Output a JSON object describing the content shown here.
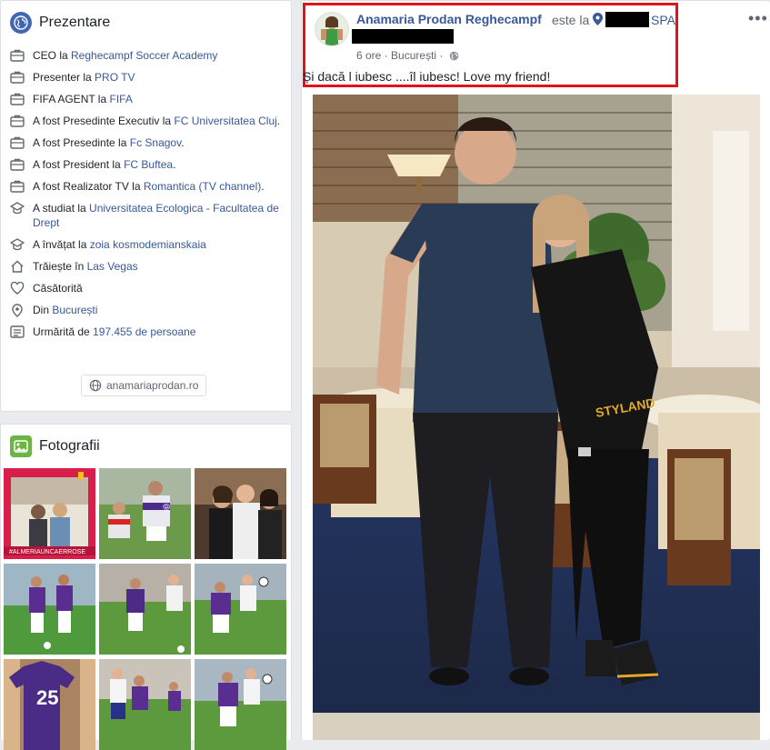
{
  "intro": {
    "title": "Prezentare",
    "items": [
      {
        "icon": "briefcase-icon",
        "prefix": "CEO la ",
        "link": "Reghecampf Soccer Academy",
        "suffix": ""
      },
      {
        "icon": "briefcase-icon",
        "prefix": "Presenter la ",
        "link": "PRO TV",
        "suffix": ""
      },
      {
        "icon": "briefcase-icon",
        "prefix": "FIFA AGENT la ",
        "link": "FIFA",
        "suffix": ""
      },
      {
        "icon": "briefcase-icon",
        "prefix": "A fost Presedinte Executiv la ",
        "link": "FC Universitatea Cluj",
        "suffix": "."
      },
      {
        "icon": "briefcase-icon",
        "prefix": "A fost Presedinte la ",
        "link": "Fc Snagov",
        "suffix": "."
      },
      {
        "icon": "briefcase-icon",
        "prefix": "A fost President la ",
        "link": "FC Buftea",
        "suffix": "."
      },
      {
        "icon": "briefcase-icon",
        "prefix": "A fost Realizator TV la ",
        "link": "Romantica (TV channel)",
        "suffix": "."
      },
      {
        "icon": "graduation-cap-icon",
        "prefix": "A studiat la ",
        "link": "Universitatea Ecologica - Facultatea de Drept",
        "suffix": ""
      },
      {
        "icon": "graduation-cap-icon",
        "prefix": "A învățat la ",
        "link": "zoia kosmodemianskaia",
        "suffix": ""
      },
      {
        "icon": "home-icon",
        "prefix": "Trăiește în ",
        "link": "Las Vegas",
        "suffix": ""
      },
      {
        "icon": "heart-icon",
        "prefix": "Căsătorită",
        "link": "",
        "suffix": ""
      },
      {
        "icon": "location-pin-icon",
        "prefix": "Din ",
        "link": "București",
        "suffix": ""
      },
      {
        "icon": "feed-icon",
        "prefix": "Urmărită de ",
        "link": "197.455 de persoane",
        "suffix": ""
      }
    ],
    "website": "anamariaprodan.ro"
  },
  "photos": {
    "title": "Fotografii",
    "captions": [
      "#ALMERIAUNCAERROSE",
      "25"
    ]
  },
  "post": {
    "author": "Anamaria Prodan Reghecampf",
    "este_la": "este la",
    "place_suffix": "SPA",
    "time": "6 ore",
    "separator": "·",
    "city": "București",
    "text": "Și dacă l iubesc ....îl iubesc! Love my friend!",
    "photo_text": "STYLAND"
  },
  "colors": {
    "link": "#385898",
    "highlight": "#e0131a",
    "background": "#e9ebee"
  }
}
